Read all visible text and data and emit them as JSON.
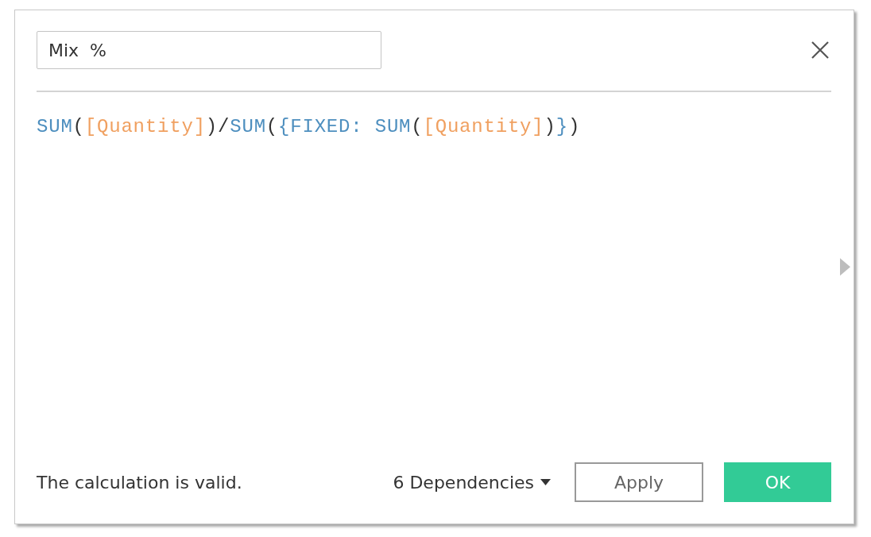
{
  "name_field": {
    "value": "Mix  %"
  },
  "formula": [
    {
      "kind": "function",
      "text": "SUM"
    },
    {
      "kind": "paren",
      "text": "("
    },
    {
      "kind": "field",
      "text": "[Quantity]"
    },
    {
      "kind": "paren",
      "text": ")"
    },
    {
      "kind": "operator",
      "text": "/"
    },
    {
      "kind": "function",
      "text": "SUM"
    },
    {
      "kind": "paren",
      "text": "("
    },
    {
      "kind": "brace",
      "text": "{"
    },
    {
      "kind": "function",
      "text": "FIXED: SUM"
    },
    {
      "kind": "paren",
      "text": "("
    },
    {
      "kind": "field",
      "text": "[Quantity]"
    },
    {
      "kind": "paren",
      "text": ")"
    },
    {
      "kind": "brace",
      "text": "}"
    },
    {
      "kind": "paren",
      "text": ")"
    }
  ],
  "footer": {
    "status": "The calculation is valid.",
    "dependencies": "6 Dependencies",
    "buttons": [
      {
        "label": "Apply",
        "kind": "secondary"
      },
      {
        "label": "OK",
        "kind": "primary"
      }
    ]
  }
}
